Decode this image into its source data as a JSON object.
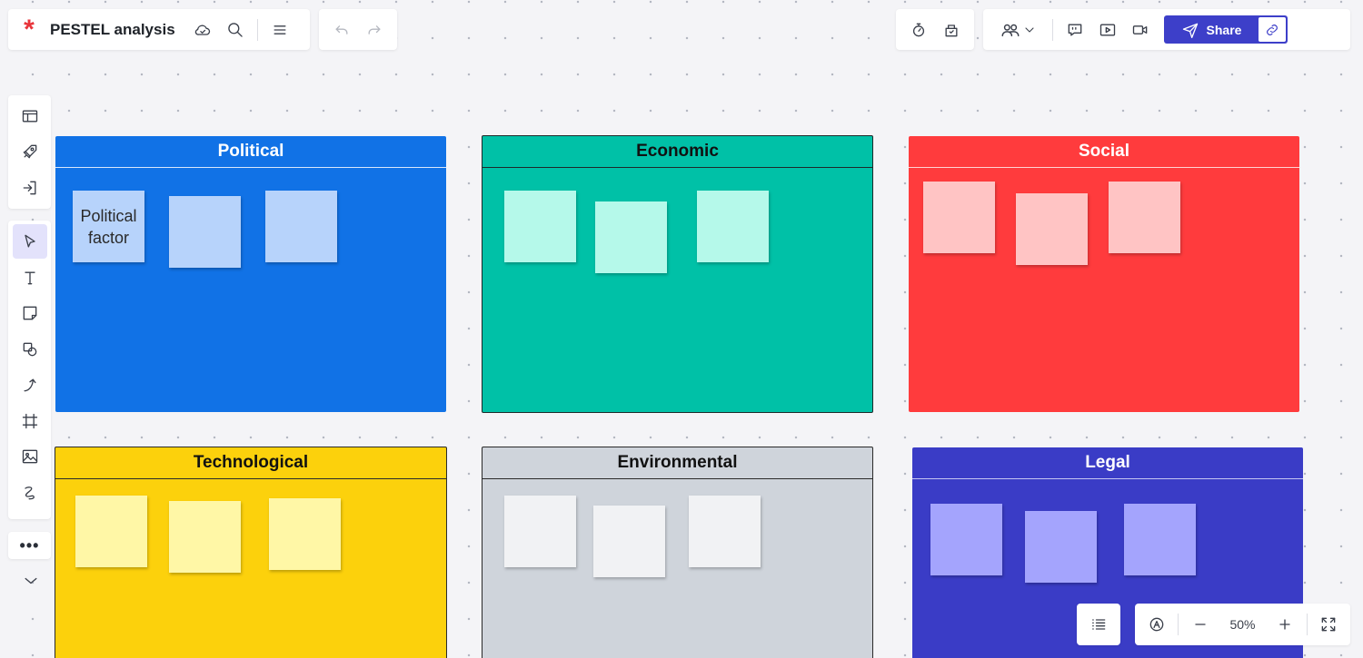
{
  "app": {
    "logo": "*",
    "document_title": "PESTEL analysis"
  },
  "toolbar": {
    "share_label": "Share"
  },
  "frames": {
    "political": {
      "title": "Political",
      "notes": [
        "Political\nfactor",
        "",
        ""
      ]
    },
    "economic": {
      "title": "Economic"
    },
    "social": {
      "title": "Social"
    },
    "technological": {
      "title": "Technological"
    },
    "environmental": {
      "title": "Environmental"
    },
    "legal": {
      "title": "Legal"
    }
  },
  "zoom": {
    "level": "50%"
  },
  "icons": {
    "top_left": [
      "cloud-check-icon",
      "search-icon",
      "menu-icon"
    ],
    "history": [
      "undo-icon",
      "redo-icon"
    ],
    "timer": [
      "timer-icon",
      "vote-icon"
    ],
    "collaboration": [
      "collaborators-icon",
      "chevron-down-icon",
      "comment-icon",
      "present-icon",
      "video-icon",
      "send-icon",
      "link-icon"
    ],
    "left_tools": [
      "templates-icon",
      "rocket-icon",
      "import-icon",
      "select-icon",
      "text-icon",
      "sticky-note-icon",
      "shapes-icon",
      "connector-icon",
      "frame-icon",
      "image-icon",
      "pen-icon",
      "more-icon",
      "chevron-down-icon"
    ],
    "bottom": [
      "list-icon",
      "navigate-icon",
      "zoom-out-icon",
      "zoom-in-icon",
      "fullscreen-icon"
    ]
  },
  "colors": {
    "political": "#1172e6",
    "economic": "#00c1a7",
    "social": "#ff3b3d",
    "technological": "#fcd10c",
    "environmental": "#cfd4db",
    "legal": "#3a3cc6",
    "accent": "#3d3fc9",
    "brand": "#e8343a"
  }
}
